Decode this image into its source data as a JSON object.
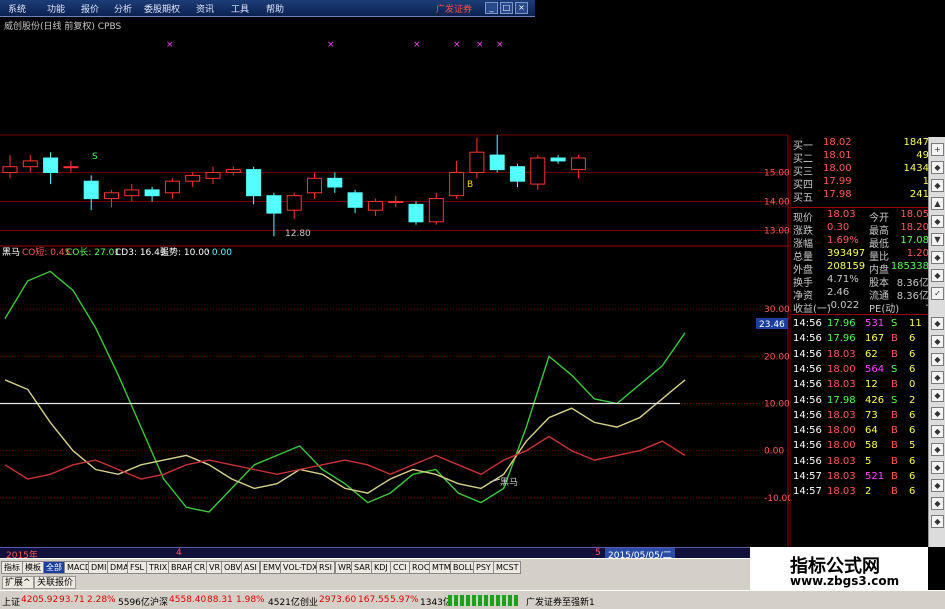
{
  "menu": {
    "items": [
      "系统",
      "功能",
      "报价",
      "分析",
      "委股期权",
      "资讯",
      "工具",
      "帮助"
    ],
    "brand": "广发证券"
  },
  "chart_header": {
    "title": "威创股份(日线 前复权) CPBS",
    "min_price_label": "12.80",
    "buy_marker": "B",
    "sell_marker": "S"
  },
  "price_axis": [
    "15.00",
    "14.00",
    "13.00"
  ],
  "indicator_header": {
    "name": "黑马",
    "co_short": "CO短: 0.45",
    "co_long": "CO长: 27.01",
    "cd3": "CD3: 16.43",
    "trend": "强势: 10.00",
    "extra": ": 0.00"
  },
  "indicator_axis": [
    "30.00",
    "20.00",
    "10.00",
    "0.00",
    "-10.00"
  ],
  "current_value_label": "23.46",
  "cross_label": "黑马",
  "date_bar": {
    "year": "2015年",
    "mark_4": "4",
    "mark_5": "5",
    "date": "2015/05/05/二"
  },
  "quote": {
    "book": [
      {
        "label": "买一",
        "price": "18.02",
        "vol": "1847"
      },
      {
        "label": "买二",
        "price": "18.01",
        "vol": "49"
      },
      {
        "label": "买三",
        "price": "18.00",
        "vol": "1434"
      },
      {
        "label": "买四",
        "price": "17.99",
        "vol": "1"
      },
      {
        "label": "买五",
        "price": "17.98",
        "vol": "241"
      }
    ],
    "stats": [
      {
        "l1": "现价",
        "v1": "18.03",
        "l2": "今开",
        "v2": "18.05"
      },
      {
        "l1": "涨跌",
        "v1": "0.30",
        "l2": "最高",
        "v2": "18.20"
      },
      {
        "l1": "涨幅",
        "v1": "1.69%",
        "l2": "最低",
        "v2": "17.08"
      },
      {
        "l1": "总量",
        "v1": "393497",
        "l2": "量比",
        "v2": "1.20"
      },
      {
        "l1": "外盘",
        "v1": "208159",
        "l2": "内盘",
        "v2": "185338"
      },
      {
        "l1": "换手",
        "v1": "4.71%",
        "l2": "股本",
        "v2": "8.36亿"
      },
      {
        "l1": "净资",
        "v1": "2.46",
        "l2": "流通",
        "v2": "8.36亿"
      },
      {
        "l1": "收益(一)",
        "v1": "-0.022",
        "l2": "PE(动)",
        "v2": "-"
      }
    ],
    "ticks": [
      {
        "time": "14:56",
        "price": "17.96",
        "vol": "531",
        "flag": "S",
        "n": "11"
      },
      {
        "time": "14:56",
        "price": "17.96",
        "vol": "167",
        "flag": "B",
        "n": "6"
      },
      {
        "time": "14:56",
        "price": "18.03",
        "vol": "62",
        "flag": "B",
        "n": "6"
      },
      {
        "time": "14:56",
        "price": "18.00",
        "vol": "564",
        "flag": "S",
        "n": "6"
      },
      {
        "time": "14:56",
        "price": "18.03",
        "vol": "12",
        "flag": "B",
        "n": "0"
      },
      {
        "time": "14:56",
        "price": "17.98",
        "vol": "426",
        "flag": "S",
        "n": "2"
      },
      {
        "time": "14:56",
        "price": "18.03",
        "vol": "73",
        "flag": "B",
        "n": "6"
      },
      {
        "time": "14:56",
        "price": "18.00",
        "vol": "64",
        "flag": "B",
        "n": "6"
      },
      {
        "time": "14:56",
        "price": "18.00",
        "vol": "58",
        "flag": "B",
        "n": "5"
      },
      {
        "time": "14:56",
        "price": "18.03",
        "vol": "5",
        "flag": "B",
        "n": "6"
      },
      {
        "time": "14:57",
        "price": "18.03",
        "vol": "521",
        "flag": "B",
        "n": "6"
      },
      {
        "time": "14:57",
        "price": "18.03",
        "vol": "2",
        "flag": "B",
        "n": "6"
      }
    ]
  },
  "tabs": [
    "指标",
    "模板",
    "全部",
    "MACD",
    "DMI",
    "DMA",
    "FSL",
    "TRIX",
    "BRAR",
    "CR",
    "VR",
    "OBV",
    "ASI",
    "EMV",
    "VOL-TDX",
    "RSI",
    "WR",
    "SAR",
    "KDJ",
    "CCI",
    "ROC",
    "MTM",
    "BOLL",
    "PSY",
    "MCST"
  ],
  "tabs2": [
    "扩展^",
    "关联报价"
  ],
  "status": {
    "sh_label": "上证",
    "sh_value": "4205.92",
    "sh_change": "93.71",
    "sh_pct": "2.28%",
    "sh_amount": "5596亿",
    "hs_label": "沪深",
    "hs_value": "4558.40",
    "hs_change": "88.31",
    "hs_pct": "1.98%",
    "hs_amount": "4521亿",
    "cy_label": "创业",
    "cy_value": "2973.60",
    "cy_change": "167.55",
    "cy_pct": "5.97%",
    "cy_amount": "1343亿",
    "broker": "广发证券至强新1"
  },
  "watermark": {
    "title": "指标公式网",
    "url": "www.zbgs3.com"
  },
  "colors": {
    "up": "#ff3232",
    "down": "#54ffff",
    "line_white": "#e6e6e6",
    "line_green": "#3cc83c",
    "line_yellow": "#d8d08a",
    "line_red": "#c83232",
    "grid": "#700000"
  },
  "chart_data": [
    {
      "type": "candlestick",
      "title": "威创股份(日线 前复权) CPBS",
      "ylim": [
        12.5,
        16.5
      ],
      "y_ticks": [
        13,
        14,
        15
      ],
      "candles": [
        {
          "o": 15.0,
          "c": 15.2,
          "h": 15.6,
          "l": 14.8
        },
        {
          "o": 15.2,
          "c": 15.4,
          "h": 15.6,
          "l": 15.0
        },
        {
          "o": 15.5,
          "c": 15.0,
          "h": 15.7,
          "l": 14.6
        },
        {
          "o": 15.2,
          "c": 15.2,
          "h": 15.4,
          "l": 15.0
        },
        {
          "o": 14.7,
          "c": 14.1,
          "h": 14.9,
          "l": 13.7
        },
        {
          "o": 14.1,
          "c": 14.3,
          "h": 14.4,
          "l": 13.8
        },
        {
          "o": 14.2,
          "c": 14.4,
          "h": 14.6,
          "l": 14.0
        },
        {
          "o": 14.4,
          "c": 14.2,
          "h": 14.5,
          "l": 14.0
        },
        {
          "o": 14.3,
          "c": 14.7,
          "h": 14.8,
          "l": 14.1
        },
        {
          "o": 14.7,
          "c": 14.9,
          "h": 15.0,
          "l": 14.5
        },
        {
          "o": 14.8,
          "c": 15.0,
          "h": 15.2,
          "l": 14.6
        },
        {
          "o": 15.0,
          "c": 15.1,
          "h": 15.2,
          "l": 14.9
        },
        {
          "o": 15.1,
          "c": 14.2,
          "h": 15.2,
          "l": 13.9
        },
        {
          "o": 14.2,
          "c": 13.6,
          "h": 14.3,
          "l": 12.8
        },
        {
          "o": 13.7,
          "c": 14.2,
          "h": 14.3,
          "l": 13.4
        },
        {
          "o": 14.3,
          "c": 14.8,
          "h": 15.0,
          "l": 14.1
        },
        {
          "o": 14.8,
          "c": 14.5,
          "h": 15.0,
          "l": 14.3
        },
        {
          "o": 14.3,
          "c": 13.8,
          "h": 14.4,
          "l": 13.6
        },
        {
          "o": 13.7,
          "c": 14.0,
          "h": 14.1,
          "l": 13.5
        },
        {
          "o": 14.0,
          "c": 14.0,
          "h": 14.2,
          "l": 13.8
        },
        {
          "o": 13.9,
          "c": 13.3,
          "h": 14.0,
          "l": 13.2
        },
        {
          "o": 13.3,
          "c": 14.1,
          "h": 14.3,
          "l": 13.2
        },
        {
          "o": 14.2,
          "c": 15.0,
          "h": 15.4,
          "l": 14.1
        },
        {
          "o": 15.0,
          "c": 15.7,
          "h": 16.2,
          "l": 14.8
        },
        {
          "o": 15.6,
          "c": 15.1,
          "h": 16.3,
          "l": 15.0
        },
        {
          "o": 15.2,
          "c": 14.7,
          "h": 15.3,
          "l": 14.5
        },
        {
          "o": 14.6,
          "c": 15.5,
          "h": 15.6,
          "l": 14.4
        },
        {
          "o": 15.5,
          "c": 15.4,
          "h": 15.6,
          "l": 15.3
        },
        {
          "o": 15.1,
          "c": 15.5,
          "h": 15.6,
          "l": 14.8
        }
      ]
    },
    {
      "type": "line",
      "title": "黑马",
      "ylim": [
        -20,
        40
      ],
      "y_ticks": [
        -10,
        0,
        10,
        20,
        30
      ],
      "x": [
        0,
        1,
        2,
        3,
        4,
        5,
        6,
        7,
        8,
        9,
        10,
        11,
        12,
        13,
        14,
        15,
        16,
        17,
        18,
        19,
        20,
        21,
        22,
        23,
        24,
        25,
        26,
        27,
        28,
        29
      ],
      "series": [
        {
          "name": "CO长",
          "color": "green",
          "values": [
            28,
            36,
            38,
            34,
            26,
            16,
            5,
            -6,
            -12,
            -13,
            -8,
            -3,
            -1,
            1,
            -4,
            -7,
            -11,
            -9,
            -5,
            -4,
            -9,
            -11,
            -8,
            5,
            20,
            16,
            11,
            10,
            14,
            18,
            25
          ]
        },
        {
          "name": "CO短",
          "color": "yellow",
          "values": [
            15,
            13,
            6,
            0,
            -4,
            -5,
            -3,
            -2,
            -1,
            -3,
            -6,
            -8,
            -7,
            -4,
            -5,
            -8,
            -9,
            -6,
            -4,
            -5,
            -7,
            -8,
            -5,
            2,
            7,
            9,
            6,
            5,
            7,
            11,
            15
          ]
        },
        {
          "name": "CD3",
          "color": "red",
          "values": [
            -3,
            -6,
            -5,
            -3,
            -2,
            -4,
            -6,
            -5,
            -3,
            -2,
            -3,
            -4,
            -5,
            -4,
            -3,
            -2,
            -3,
            -5,
            -3,
            -1,
            -3,
            -5,
            -2,
            0,
            3,
            0,
            -2,
            -1,
            0,
            2,
            -1
          ]
        },
        {
          "name": "强势",
          "color": "white",
          "values": [
            10,
            10,
            10,
            10,
            10,
            10,
            10,
            10,
            10,
            10,
            10,
            10,
            10,
            10,
            10,
            10,
            10,
            10,
            10,
            10,
            10,
            10,
            10,
            10,
            10,
            10,
            10,
            10,
            10,
            10,
            10
          ]
        }
      ]
    }
  ]
}
